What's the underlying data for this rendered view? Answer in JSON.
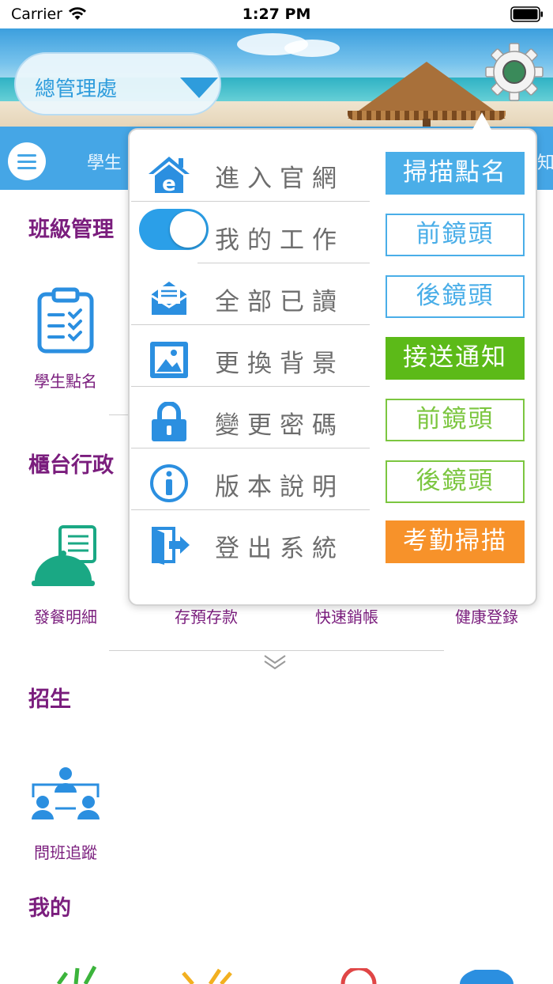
{
  "status_bar": {
    "carrier": "Carrier",
    "time": "1:27 PM"
  },
  "header": {
    "org_selector": "總管理處"
  },
  "nav": {
    "items": [
      "學生",
      "知"
    ]
  },
  "sections": [
    {
      "title": "班級管理",
      "items": [
        "學生點名"
      ]
    },
    {
      "title": "櫃台行政",
      "items": [
        "發餐明細",
        "存預存款",
        "快速銷帳",
        "健康登錄"
      ]
    },
    {
      "title": "招生",
      "items": [
        "問班追蹤"
      ]
    },
    {
      "title": "我的",
      "items": []
    }
  ],
  "popup": {
    "menu_items": [
      {
        "label": "進入官網",
        "icon": "website-home-icon"
      },
      {
        "label": "我的工作",
        "icon": "toggle-switch",
        "toggle_on": true
      },
      {
        "label": "全部已讀",
        "icon": "mail-open-icon"
      },
      {
        "label": "更換背景",
        "icon": "image-icon"
      },
      {
        "label": "變更密碼",
        "icon": "lock-icon"
      },
      {
        "label": "版本說明",
        "icon": "info-icon"
      },
      {
        "label": "登出系統",
        "icon": "logout-door-icon"
      }
    ],
    "side_buttons": [
      {
        "label": "掃描點名",
        "style": "filled",
        "color": "#4aaee8"
      },
      {
        "label": "前鏡頭",
        "style": "outline",
        "color": "#4aaee8"
      },
      {
        "label": "後鏡頭",
        "style": "outline",
        "color": "#4aaee8"
      },
      {
        "label": "接送通知",
        "style": "filled",
        "color": "#5cba18"
      },
      {
        "label": "前鏡頭",
        "style": "outline",
        "color": "#7cc640"
      },
      {
        "label": "後鏡頭",
        "style": "outline",
        "color": "#7cc640"
      },
      {
        "label": "考勤掃描",
        "style": "filled",
        "color": "#f7922a"
      }
    ]
  },
  "colors": {
    "accent_blue": "#45a6e6",
    "section_purple": "#7a1d7d",
    "green": "#5cba18",
    "orange": "#f7922a"
  }
}
